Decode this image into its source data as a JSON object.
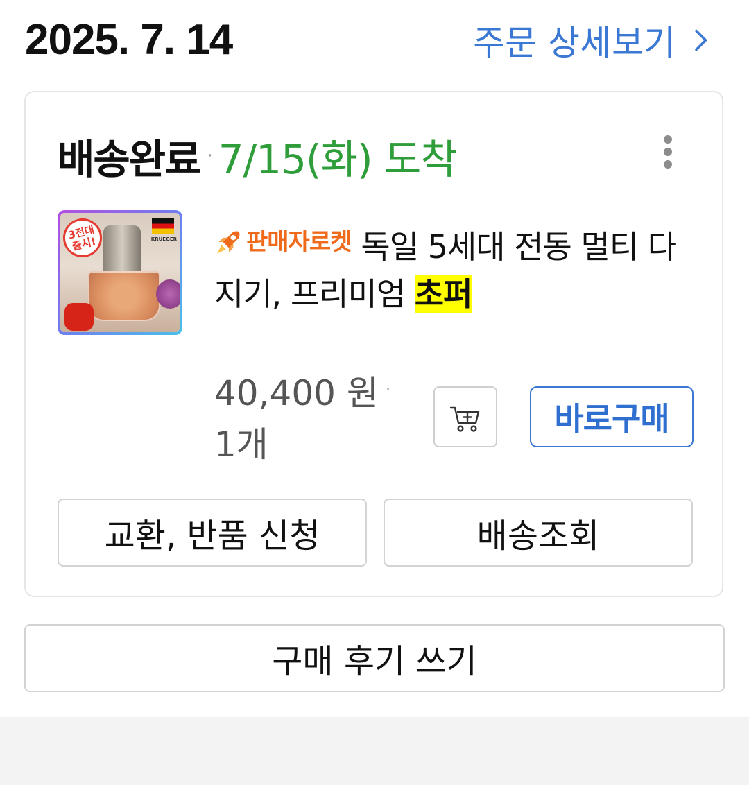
{
  "order": {
    "date": "2025. 7. 14",
    "detail_link": "주문 상세보기"
  },
  "delivery": {
    "status": "배송완료",
    "separator": "·",
    "arrival": "7/15(화) 도착"
  },
  "product": {
    "badge_label": "판매자로켓",
    "title_main": "독일 5세대 전동 멀티 다지기, 프리미엄 ",
    "title_highlight": "초퍼",
    "thumb_badge": "3전대\n출시!",
    "price": "40,400 원",
    "quantity": "1개"
  },
  "buttons": {
    "buy_now": "바로구매",
    "return_exchange": "교환, 반품 신청",
    "track_delivery": "배송조회",
    "write_review": "구매 후기 쓰기"
  },
  "colors": {
    "link_blue": "#3a78d4",
    "arrival_green": "#2e9d3a",
    "rocket_orange": "#f06a1c",
    "highlight_yellow": "#ffff00"
  },
  "icons": {
    "detail": "chevron-right-icon",
    "more": "more-vertical-icon",
    "cart": "cart-plus-icon",
    "rocket": "rocket-icon"
  }
}
